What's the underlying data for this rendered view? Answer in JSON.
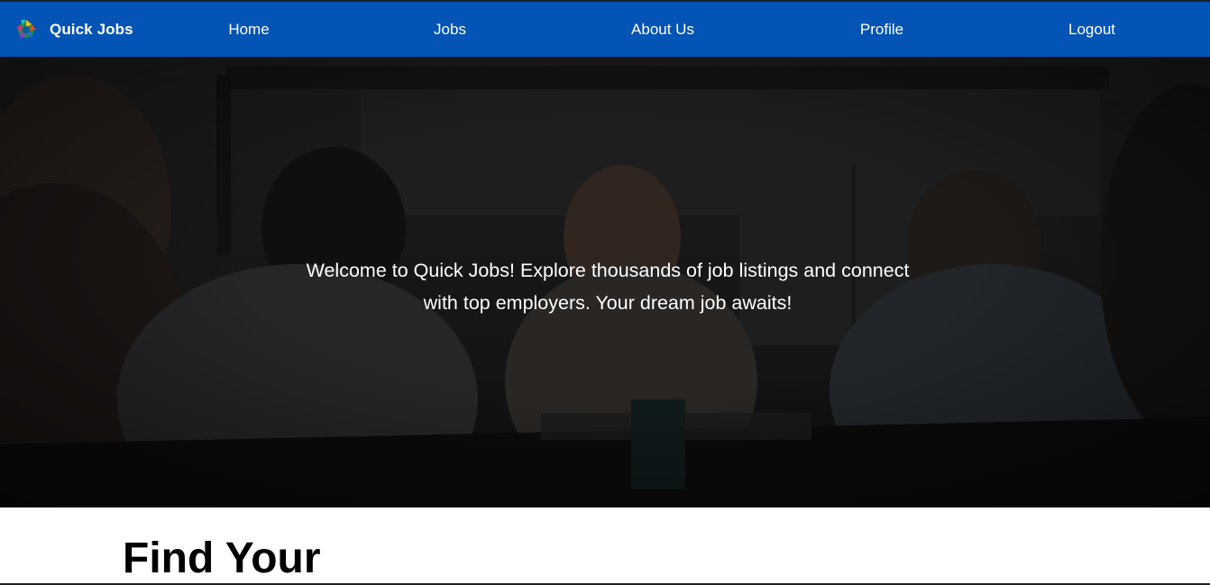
{
  "navbar": {
    "brand": {
      "logo_icon": "colorful-globe-logo-icon",
      "name": "Quick Jobs"
    },
    "links": [
      {
        "label": "Home"
      },
      {
        "label": "Jobs"
      },
      {
        "label": "About Us"
      },
      {
        "label": "Profile"
      },
      {
        "label": "Logout"
      }
    ],
    "background_color": "#0354b4"
  },
  "hero": {
    "background_image": "people in a business meeting around a table (darkened)",
    "text": "Welcome to Quick Jobs! Explore thousands of job listings and connect with top employers. Your dream job awaits!"
  },
  "section": {
    "title": "Find Your"
  }
}
